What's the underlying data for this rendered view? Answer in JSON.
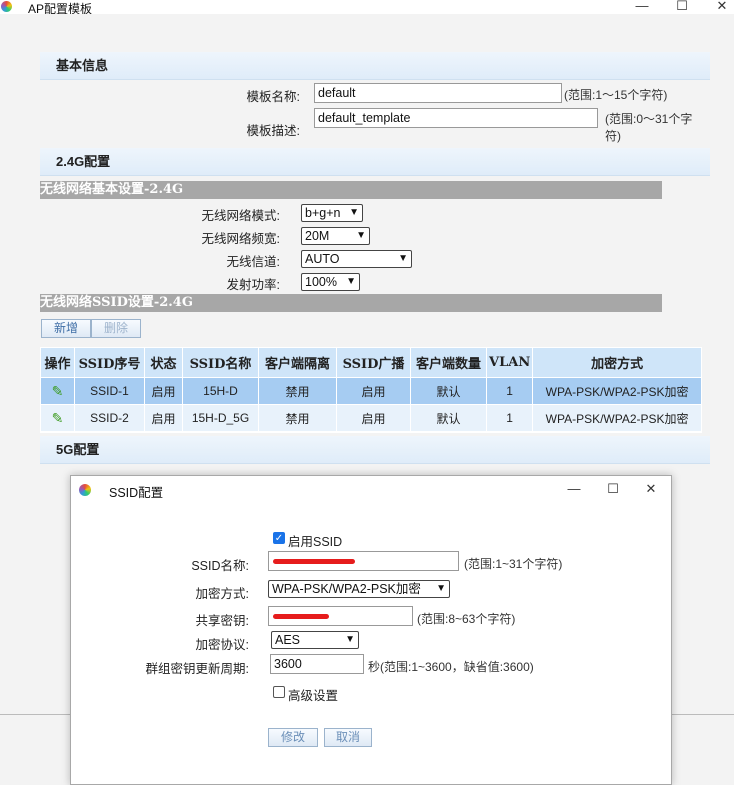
{
  "window": {
    "title": "AP配置模板",
    "controls": {
      "minimize": "—",
      "maximize": "☐",
      "close": "✕"
    }
  },
  "basic": {
    "header": "基本信息",
    "template_name_label": "模板名称:",
    "template_name_value": "default",
    "template_name_hint": "(范围:1～15个字符)",
    "template_desc_label": "模板描述:",
    "template_desc_value": "default_template",
    "template_desc_hint": "(范围:0～31个字符)"
  },
  "band24": {
    "header": "2.4G配置",
    "basic_sub": "无线网络基本设置-2.4G",
    "mode_label": "无线网络模式:",
    "mode_value": "b+g+n",
    "bandwidth_label": "无线网络频宽:",
    "bandwidth_value": "20M",
    "channel_label": "无线信道:",
    "channel_value": "AUTO",
    "power_label": "发射功率:",
    "power_value": "100%",
    "ssid_sub": "无线网络SSID设置-2.4G",
    "add_label": "新增",
    "delete_label": "删除",
    "columns": [
      "操作",
      "SSID序号",
      "状态",
      "SSID名称",
      "客户端隔离",
      "SSID广播",
      "客户端数量",
      "VLAN",
      "加密方式"
    ],
    "rows": [
      {
        "id": "SSID-1",
        "status": "启用",
        "name": "15H-D",
        "isolation": "禁用",
        "broadcast": "启用",
        "clients": "默认",
        "vlan": "1",
        "encryption": "WPA-PSK/WPA2-PSK加密"
      },
      {
        "id": "SSID-2",
        "status": "启用",
        "name": "15H-D_5G",
        "isolation": "禁用",
        "broadcast": "启用",
        "clients": "默认",
        "vlan": "1",
        "encryption": "WPA-PSK/WPA2-PSK加密"
      }
    ]
  },
  "band5": {
    "header": "5G配置"
  },
  "dialog": {
    "title": "SSID配置",
    "controls": {
      "minimize": "—",
      "maximize": "☐",
      "close": "✕"
    },
    "enable_label": "启用SSID",
    "ssid_name_label": "SSID名称:",
    "ssid_name_hint": "(范围:1~31个字符)",
    "encryption_label": "加密方式:",
    "encryption_value": "WPA-PSK/WPA2-PSK加密",
    "psk_label": "共享密钥:",
    "psk_hint": "(范围:8~63个字符)",
    "protocol_label": "加密协议:",
    "protocol_value": "AES",
    "group_key_label": "群组密钥更新周期:",
    "group_key_value": "3600",
    "group_key_hint": "秒(范围:1~3600，缺省值:3600)",
    "advanced_label": "高级设置",
    "modify_label": "修改",
    "cancel_label": "取消",
    "colors": {
      "redaction": "#e61c1c",
      "checkbox": "#1a73e8"
    }
  }
}
